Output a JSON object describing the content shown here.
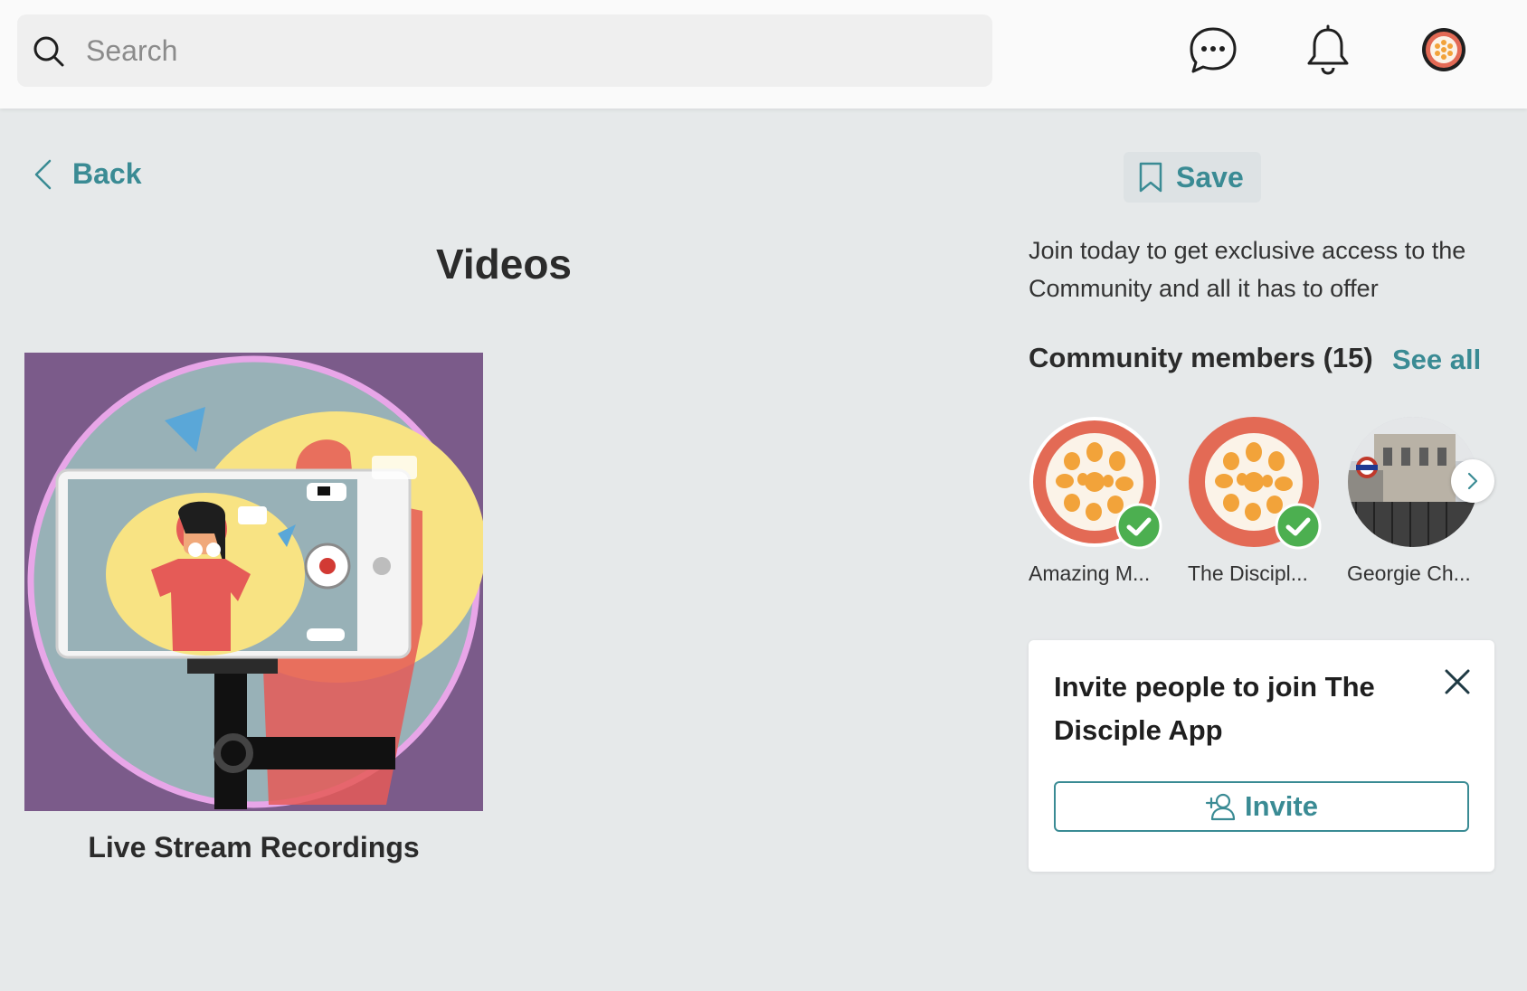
{
  "topbar": {
    "search_placeholder": "Search",
    "icons": [
      "search-icon",
      "chat-icon",
      "bell-icon",
      "user-avatar"
    ]
  },
  "nav": {
    "back_label": "Back",
    "save_label": "Save"
  },
  "main": {
    "title": "Videos",
    "cards": [
      {
        "label": "Live Stream Recordings"
      }
    ]
  },
  "sidebar": {
    "promo_text": "Join today to get exclusive access to the Community and all it has to offer",
    "members_heading": "Community members (15)",
    "see_all_label": "See all",
    "members": [
      {
        "name": "Amazing M...",
        "verified": true
      },
      {
        "name": "The Discipl...",
        "verified": true
      },
      {
        "name": "Georgie Ch...",
        "verified": false
      }
    ],
    "invite": {
      "title": "Invite people to join The Disciple App",
      "button_label": "Invite"
    }
  },
  "colors": {
    "accent": "#3a8b94",
    "background": "#e6e9ea",
    "verified": "#4caf50",
    "card_purple": "#7b5b8a"
  }
}
